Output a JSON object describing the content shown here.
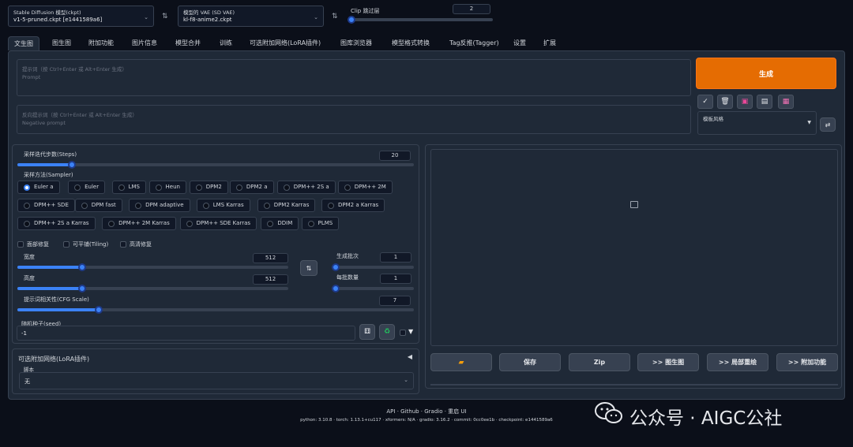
{
  "header": {
    "model_label": "Stable Diffusion 模型(ckpt)",
    "model_value": "v1-5-pruned.ckpt [e1441589a6]",
    "vae_label": "模型的 VAE (SD VAE)",
    "vae_value": "kl-f8-anime2.ckpt",
    "clip_label": "Clip 跳过层",
    "clip_value": "2",
    "clip_fraction": 0.0
  },
  "tabs": [
    "文生图",
    "图生图",
    "附加功能",
    "图片信息",
    "模型合并",
    "训练",
    "可选附加网络(LoRA插件)",
    "图库浏览器",
    "模型格式转换",
    "Tag反推(Tagger)",
    "设置",
    "扩展"
  ],
  "prompt": {
    "label": "提示词（按 Ctrl+Enter 或 Alt+Enter 生成）",
    "placeholder": "Prompt",
    "neg_label": "反向提示词（按 Ctrl+Enter 或 Alt+Enter 生成）",
    "neg_placeholder": "Negative prompt"
  },
  "generate_label": "生成",
  "style": {
    "label": "模板风格"
  },
  "steps": {
    "label": "采样迭代步数(Steps)",
    "value": "20",
    "fraction": 0.13
  },
  "sampler": {
    "label": "采样方法(Sampler)",
    "options": [
      "Euler a",
      "Euler",
      "LMS",
      "Heun",
      "DPM2",
      "DPM2 a",
      "DPM++ 2S a",
      "DPM++ 2M",
      "DPM++ SDE",
      "DPM fast",
      "DPM adaptive",
      "LMS Karras",
      "DPM2 Karras",
      "DPM2 a Karras",
      "DPM++ 2S a Karras",
      "DPM++ 2M Karras",
      "DPM++ SDE Karras",
      "DDIM",
      "PLMS"
    ],
    "selected": "Euler a"
  },
  "checks": {
    "restore": "面部修复",
    "tiling": "可平铺(Tiling)",
    "hires": "高清修复"
  },
  "width": {
    "label": "宽度",
    "value": "512",
    "fraction": 0.23
  },
  "height": {
    "label": "高度",
    "value": "512",
    "fraction": 0.23
  },
  "batch_count": {
    "label": "生成批次",
    "value": "1",
    "fraction": 0.0
  },
  "batch_size": {
    "label": "每批数量",
    "value": "1",
    "fraction": 0.0
  },
  "cfg": {
    "label": "提示词相关性(CFG Scale)",
    "value": "7",
    "fraction": 0.2
  },
  "seed": {
    "label": "随机种子(seed)",
    "value": "-1"
  },
  "lora": {
    "label": "可选附加网络(LoRA插件)"
  },
  "script": {
    "label": "脚本",
    "value": "无"
  },
  "output_buttons": {
    "save": "保存",
    "zip": "Zip",
    "to_img2img": ">> 图生图",
    "to_inpaint": ">> 局部重绘",
    "to_extras": ">> 附加功能"
  },
  "footer": {
    "links": "API · Github · Gradio · 重启 UI",
    "versions": "python: 3.10.8  ·  torch: 1.13.1+cu117  ·  xformers: N/A  ·  gradio: 3.16.2  ·  commit: 0cc0ee1b  ·  checkpoint: e1441589a6"
  },
  "watermark": "公众号 · AIGC公社",
  "colors": {
    "accent": "#3b82f6",
    "generate": "#e56c02",
    "background": "#0b0f19",
    "panel": "#1f2937"
  }
}
